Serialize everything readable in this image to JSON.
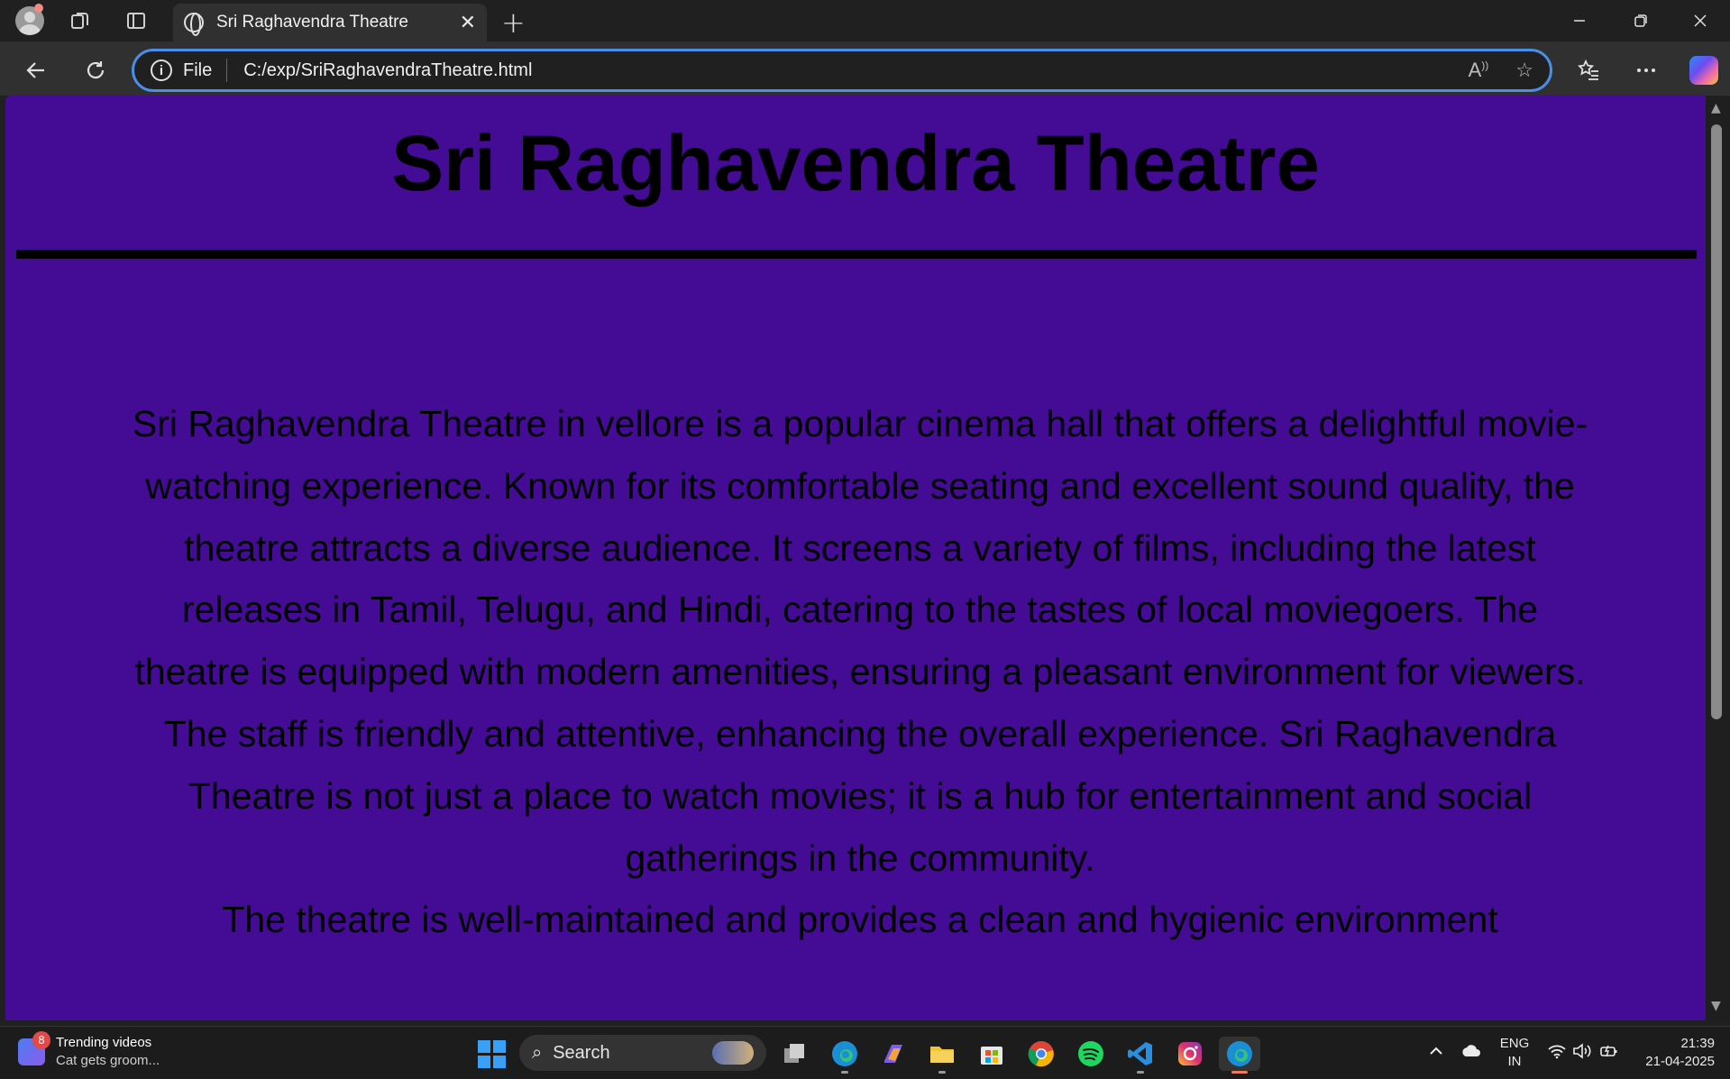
{
  "browser": {
    "tab_title": "Sri Raghavendra Theatre",
    "new_tab_symbol": "+",
    "close_tab_symbol": "✕",
    "address_scheme": "File",
    "address_url": "C:/exp/SriRaghavendraTheatre.html"
  },
  "page": {
    "title": "Sri Raghavendra Theatre",
    "paragraph_1": "Sri Raghavendra Theatre in vellore is a popular cinema hall that offers a delightful movie-watching experience. Known for its comfortable seating and excellent sound quality, the theatre attracts a diverse audience. It screens a variety of films, including the latest releases in Tamil, Telugu, and Hindi, catering to the tastes of local moviegoers. The theatre is equipped with modern amenities, ensuring a pleasant environment for viewers. The staff is friendly and attentive, enhancing the overall experience. Sri Raghavendra Theatre is not just a place to watch movies; it is a hub for entertainment and social gatherings in the community.",
    "paragraph_2": "The theatre is well-maintained and provides a clean and hygienic environment",
    "background_color": "#440b95"
  },
  "taskbar": {
    "widget_badge": "8",
    "widget_title": "Trending videos",
    "widget_subtitle": "Cat gets groom...",
    "search_label": "Search",
    "lang_line1": "ENG",
    "lang_line2": "IN",
    "time": "21:39",
    "date": "21-04-2025"
  },
  "icons": [
    "profile-avatar",
    "workspaces-icon",
    "tab-actions-icon",
    "globe-icon",
    "back-icon",
    "refresh-icon",
    "info-icon",
    "read-aloud-icon",
    "favorite-star-icon",
    "favorites-icon",
    "more-icon",
    "copilot-icon"
  ]
}
